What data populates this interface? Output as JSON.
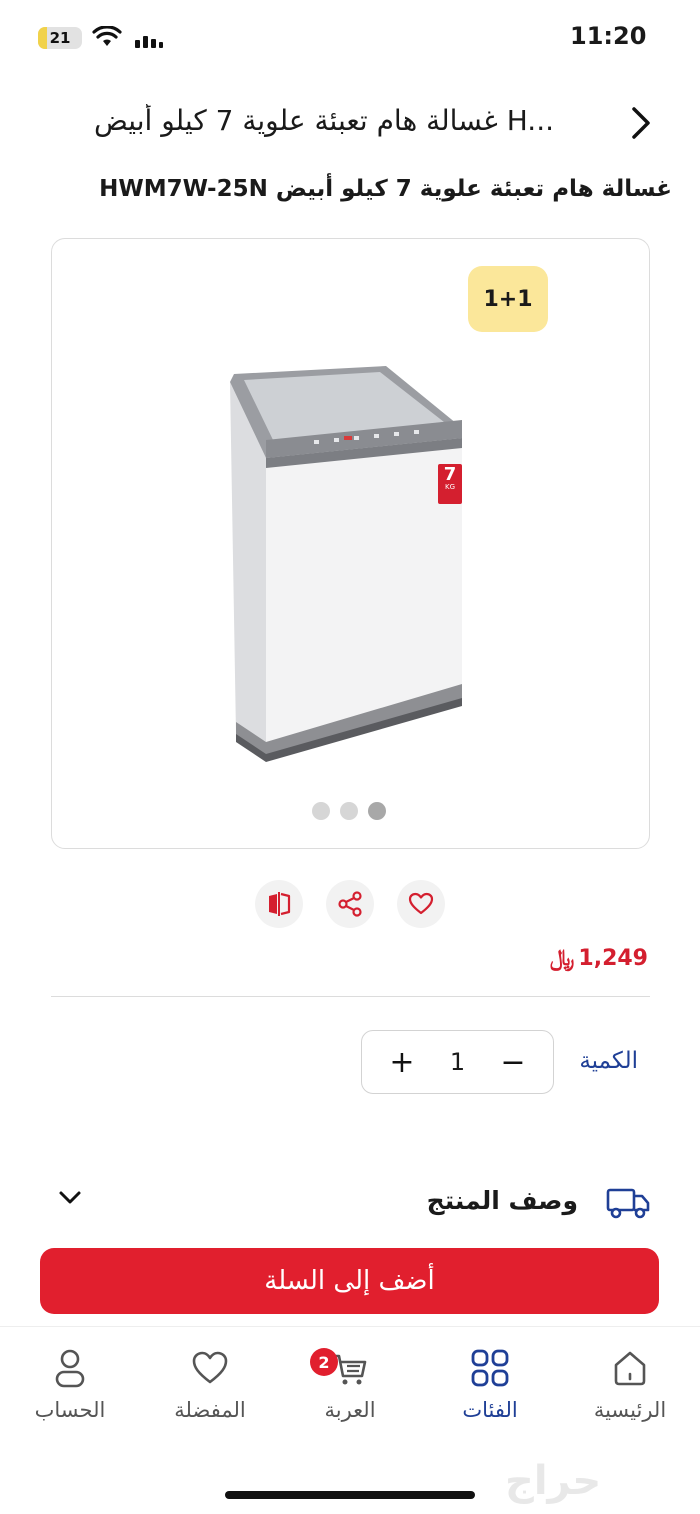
{
  "status_bar": {
    "time": "11:20",
    "battery": "21",
    "battery_level": 0.21
  },
  "header": {
    "title": "غسالة هام تعبئة علوية 7 كيلو أبيض H..."
  },
  "product": {
    "title": "غسالة هام تعبئة علوية 7 كيلو أبيض HWM7W-25N",
    "badge": "1+1",
    "capacity_label": "7",
    "capacity_unit": "KG",
    "price": "1,249",
    "currency_symbol": "﷼",
    "image_count": 3,
    "active_image": 3
  },
  "quantity": {
    "label": "الكمية",
    "value": "1",
    "minus": "−",
    "plus": "+"
  },
  "description": {
    "label": "وصف المنتج"
  },
  "cart_button": {
    "label": "أضف إلى السلة"
  },
  "nav": {
    "items": [
      {
        "label": "الحساب",
        "icon": "person-icon"
      },
      {
        "label": "المفضلة",
        "icon": "heart-icon"
      },
      {
        "label": "العربة",
        "icon": "cart-icon",
        "badge": "2"
      },
      {
        "label": "الفئات",
        "icon": "grid-icon",
        "active": true
      },
      {
        "label": "الرئيسية",
        "icon": "home-icon"
      }
    ]
  },
  "watermark": "حراج",
  "colors": {
    "accent": "#e11f2e",
    "nav_active": "#1f3f96",
    "badge_bg": "#fbe79a"
  }
}
